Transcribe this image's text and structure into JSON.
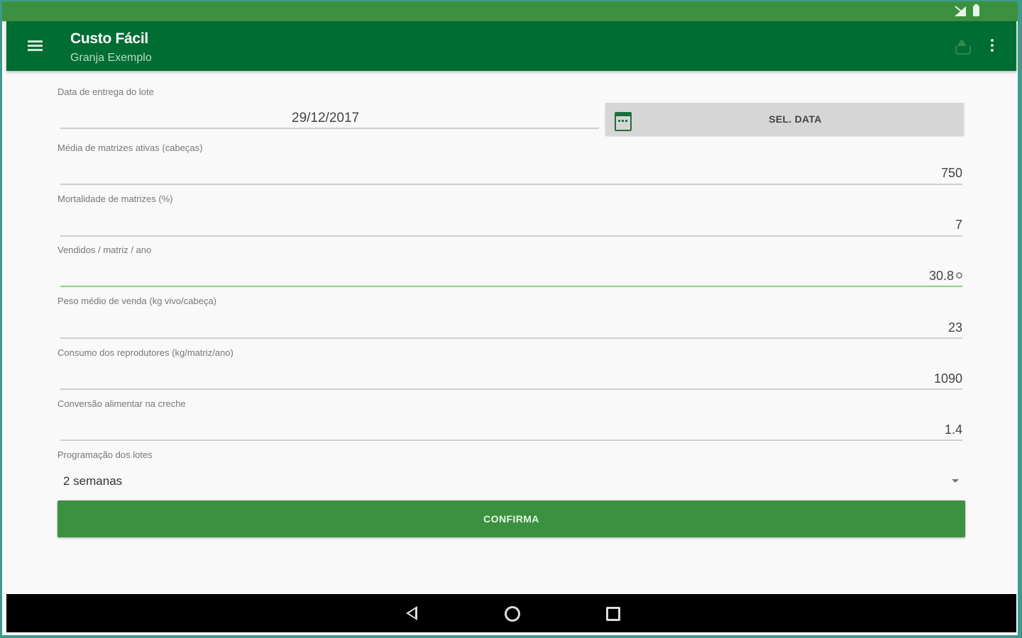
{
  "app": {
    "title": "Custo Fácil",
    "subtitle": "Granja Exemplo"
  },
  "colors": {
    "primary_dark": "#006d32",
    "primary": "#3c9140",
    "accent_line": "#8ed081"
  },
  "icons": [
    "menu-icon",
    "upload-icon",
    "more-vert-icon",
    "calendar-icon",
    "clear-icon",
    "dropdown-arrow-icon",
    "nav-back-icon",
    "nav-home-icon",
    "nav-recent-icon",
    "signal-icon",
    "battery-icon"
  ],
  "date_field": {
    "label": "Data de entrega do lote",
    "value": "29/12/2017",
    "button_label": "SEL. DATA"
  },
  "fields": [
    {
      "label": "Média de matrizes ativas (cabeças)",
      "value": "750"
    },
    {
      "label": "Mortalidade de matrizes (%)",
      "value": "7"
    },
    {
      "label": "Vendidos / matriz / ano",
      "value": "30.8"
    },
    {
      "label": "Peso médio de venda (kg vivo/cabeça)",
      "value": "23"
    },
    {
      "label": "Consumo dos reprodutores (kg/matriz/ano)",
      "value": "1090"
    },
    {
      "label": "Conversão alimentar na creche",
      "value": "1.4"
    }
  ],
  "schedule": {
    "label": "Programação dos lotes",
    "selected": "2 semanas"
  },
  "confirm_label": "CONFIRMA"
}
